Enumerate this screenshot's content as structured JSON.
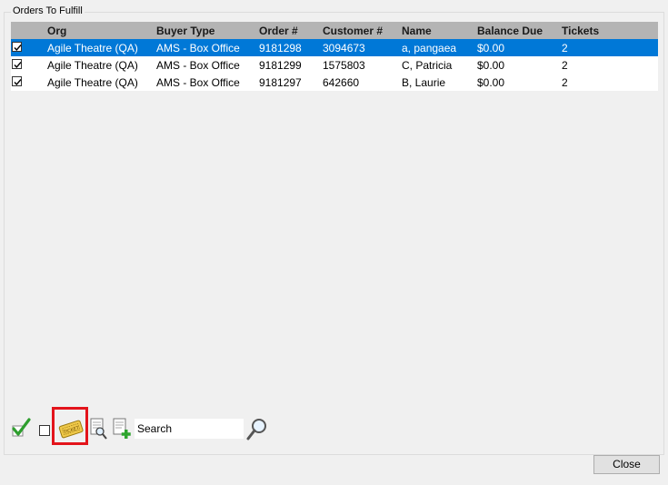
{
  "group": {
    "title": "Orders To Fulfill"
  },
  "grid": {
    "columns": [
      "Org",
      "Buyer Type",
      "Order #",
      "Customer #",
      "Name",
      "Balance Due",
      "Tickets"
    ],
    "rows": [
      {
        "checked": true,
        "org": "Agile Theatre (QA)",
        "buyer_type": "AMS - Box Office",
        "order": "9181298",
        "customer": "3094673",
        "name": "a, pangaea",
        "balance": "$0.00",
        "tickets": "2",
        "selected": true
      },
      {
        "checked": true,
        "org": "Agile Theatre (QA)",
        "buyer_type": "AMS - Box Office",
        "order": "9181299",
        "customer": "1575803",
        "name": "C, Patricia",
        "balance": "$0.00",
        "tickets": "2",
        "selected": false
      },
      {
        "checked": true,
        "org": "Agile Theatre (QA)",
        "buyer_type": "AMS - Box Office",
        "order": "9181297",
        "customer": "642660",
        "name": "B, Laurie",
        "balance": "$0.00",
        "tickets": "2",
        "selected": false
      }
    ]
  },
  "toolbar": {
    "search_value": "Search",
    "icons": [
      "green-checkmark-icon",
      "select-all-checkbox",
      "ticket-icon",
      "find-document-icon",
      "add-document-icon",
      "magnifier-icon"
    ],
    "highlight_color": "#e3141b"
  },
  "footer": {
    "close_label": "Close"
  },
  "colors": {
    "selection": "#0078d7",
    "header": "#b4b4b4",
    "background": "#f0f0f0"
  }
}
